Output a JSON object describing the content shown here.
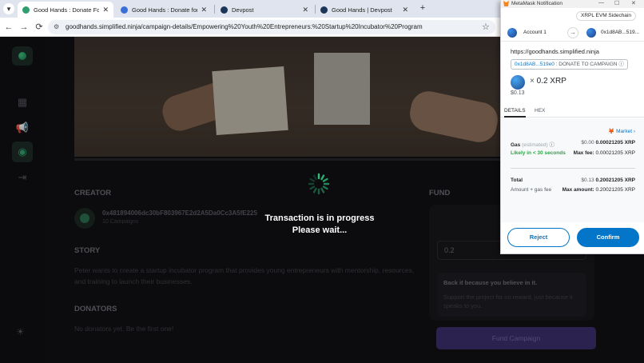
{
  "browser": {
    "tabs": [
      {
        "title": "Good Hands : Donate For a Ch",
        "active": true,
        "favicon_color": "#2f9e6c"
      },
      {
        "title": "Good Hands : Donate for a ca",
        "active": false,
        "favicon_color": "#3a6fd8"
      },
      {
        "title": "Devpost",
        "active": false,
        "favicon_color": "#1d3557"
      },
      {
        "title": "Good Hands | Devpost",
        "active": false,
        "favicon_color": "#1d3557"
      }
    ],
    "close_glyph": "✕",
    "new_tab_glyph": "+",
    "url": "goodhands.simplified.ninja/campaign-details/Empowering%20Youth%20Entrepreneurs:%20Startup%20Incubator%20Program",
    "nav": {
      "back": "←",
      "forward": "→",
      "reload": "⟳",
      "tune": "⚙",
      "star": "☆",
      "menu": "▾"
    }
  },
  "sidebar": {
    "icons": [
      "dashboard-icon",
      "campaign-icon",
      "profile-icon",
      "logout-icon",
      "theme-icon"
    ],
    "glyphs": {
      "dashboard": "▦",
      "campaign": "📢",
      "profile": "◉",
      "logout": "⇥",
      "theme": "☀"
    }
  },
  "campaign": {
    "creator_heading": "CREATOR",
    "creator_address": "0x481894006dc30bF803967E2d2A5Da0Cc3A5fE225",
    "creator_campaigns": "10 Campaigns",
    "story_heading": "STORY",
    "story_text": "Peter wants to create a startup incubator program that provides young entrepreneurs with mentorship, resources, and training to launch their businesses.",
    "donators_heading": "DONATORS",
    "donators_empty": "No donators yet. Be the first one!",
    "fund_heading": "FUND",
    "fund_card_title": "Fund",
    "fund_amount": "0.2",
    "back_title": "Back it because you believe in it.",
    "back_text": "Support the project for no reward, just because it speaks to you.",
    "fund_button": "Fund Campaign"
  },
  "overlay": {
    "line1": "Transaction is in progress",
    "line2": "Please wait..."
  },
  "metamask": {
    "window_title": "MetaMask Notification",
    "window_controls": {
      "minimize": "—",
      "maximize": "☐",
      "close": "✕"
    },
    "network": "XRPL EVM Sidechain",
    "from_account": "Account 1",
    "to_account": "0x1d8AB...519...",
    "arrow": "→",
    "origin": "https://goodhands.simplified.ninja",
    "method_address": "0x1d8AB...519e0",
    "method_name": ": DONATE TO CAMPAIGN",
    "info_glyph": "ⓘ",
    "amount_prefix": "×",
    "amount": "0.2 XRP",
    "amount_usd": "$0.13",
    "tabs": [
      "DETAILS",
      "HEX"
    ],
    "market": "Market",
    "market_chevron": "›",
    "gas_label": "Gas",
    "gas_estimated": "(estimated)",
    "gas_usd": "$0.00",
    "gas_xrp": "0.00021205 XRP",
    "likely": "Likely in < 30 seconds",
    "max_fee_label": "Max fee:",
    "max_fee_value": "0.00021205 XRP",
    "total_label": "Total",
    "total_usd": "$0.13",
    "total_xrp": "0.20021205 XRP",
    "amount_gas_label": "Amount + gas fee",
    "max_amount_label": "Max amount:",
    "max_amount_value": "0.20021205 XRP",
    "reject": "Reject",
    "confirm": "Confirm"
  }
}
